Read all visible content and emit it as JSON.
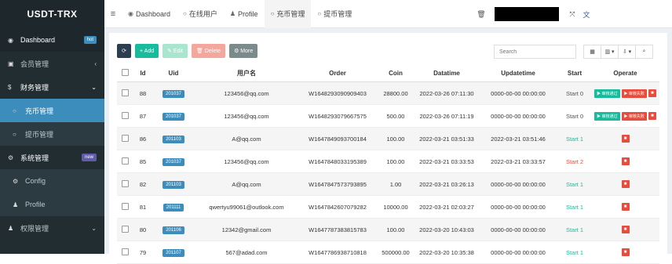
{
  "sidebar": {
    "logo": "USDT-TRX",
    "items": [
      {
        "label": "Dashboard",
        "icon": "dashboard-icon",
        "glyph": "◉",
        "badge": "hot"
      },
      {
        "label": "会员管理",
        "icon": "member-icon",
        "glyph": "▣",
        "chev": "‹"
      },
      {
        "label": "财务管理",
        "icon": "finance-icon",
        "glyph": "$",
        "chev": "⌄"
      },
      {
        "label": "充币管理",
        "icon": "circle-icon",
        "glyph": "○"
      },
      {
        "label": "提币管理",
        "icon": "circle-icon",
        "glyph": "○"
      },
      {
        "label": "系统管理",
        "icon": "gears-icon",
        "glyph": "⚙",
        "badge": "new"
      },
      {
        "label": "Config",
        "icon": "gear-icon",
        "glyph": "⚙"
      },
      {
        "label": "Profile",
        "icon": "user-icon",
        "glyph": "♟"
      },
      {
        "label": "权限管理",
        "icon": "group-icon",
        "glyph": "♟",
        "chev": "⌄"
      }
    ]
  },
  "topbar": {
    "menu_glyph": "≡",
    "tabs": [
      {
        "label": "Dashboard",
        "glyph": "◉"
      },
      {
        "label": "在线用户",
        "glyph": "○"
      },
      {
        "label": "Profile",
        "glyph": "♟"
      },
      {
        "label": "充币管理",
        "glyph": "○"
      },
      {
        "label": "提币管理",
        "glyph": "○"
      }
    ],
    "right_icons": {
      "trash": "🗑",
      "expand": "⤧",
      "lang": "文"
    }
  },
  "toolbar": {
    "refresh": "⟳",
    "add": "+ Add",
    "edit": "✎ Edit",
    "delete": "🗑 Delete",
    "more": "⚙ More",
    "search_placeholder": "Search",
    "r1": "▦",
    "r2": "▥ ▾",
    "r3": "⇩ ▾",
    "r4": "⌕"
  },
  "table": {
    "headers": {
      "id": "Id",
      "uid": "Uid",
      "name": "用户名",
      "order": "Order",
      "coin": "Coin",
      "datatime": "Datatime",
      "updatetime": "Updatetime",
      "start": "Start",
      "operate": "Operate"
    },
    "op_labels": {
      "approve": "▶ 审核通过",
      "reject": "▶ 审核失败",
      "del": "■"
    },
    "rows": [
      {
        "id": "88",
        "uid": "201037",
        "name": "123456@qq.com",
        "order": "W1648293090909403",
        "coin": "28800.00",
        "datatime": "2022-03-26 07:11:30",
        "updatetime": "0000-00-00 00:00:00",
        "start": "Start 0",
        "status": "pending"
      },
      {
        "id": "87",
        "uid": "201037",
        "name": "123456@qq.com",
        "order": "W1648293079667575",
        "coin": "500.00",
        "datatime": "2022-03-26 07:11:19",
        "updatetime": "0000-00-00 00:00:00",
        "start": "Start 0",
        "status": "pending"
      },
      {
        "id": "86",
        "uid": "201103",
        "name": "A@qq.com",
        "order": "W1647849093700184",
        "coin": "100.00",
        "datatime": "2022-03-21 03:51:33",
        "updatetime": "2022-03-21 03:51:46",
        "start": "Start 1",
        "status": "ok"
      },
      {
        "id": "85",
        "uid": "201037",
        "name": "123456@qq.com",
        "order": "W1647848033195389",
        "coin": "100.00",
        "datatime": "2022-03-21 03:33:53",
        "updatetime": "2022-03-21 03:33:57",
        "start": "Start 2",
        "status": "fail"
      },
      {
        "id": "82",
        "uid": "201103",
        "name": "A@qq.com",
        "order": "W1647847573793895",
        "coin": "1.00",
        "datatime": "2022-03-21 03:26:13",
        "updatetime": "0000-00-00 00:00:00",
        "start": "Start 1",
        "status": "ok"
      },
      {
        "id": "81",
        "uid": "201111",
        "name": "qwertyu99061@outlook.com",
        "order": "W1647842607079282",
        "coin": "10000.00",
        "datatime": "2022-03-21 02:03:27",
        "updatetime": "0000-00-00 00:00:00",
        "start": "Start 1",
        "status": "ok"
      },
      {
        "id": "80",
        "uid": "201106",
        "name": "12342@gmail.com",
        "order": "W1647787383815783",
        "coin": "100.00",
        "datatime": "2022-03-20 10:43:03",
        "updatetime": "0000-00-00 00:00:00",
        "start": "Start 1",
        "status": "ok"
      },
      {
        "id": "79",
        "uid": "201107",
        "name": "567@adad.com",
        "order": "W1647786938710818",
        "coin": "500000.00",
        "datatime": "2022-03-20 10:35:38",
        "updatetime": "0000-00-00 00:00:00",
        "start": "Start 1",
        "status": "ok"
      }
    ]
  },
  "colors": {
    "sidebar_bg": "#222d32",
    "active": "#3c8dbc",
    "green": "#18bc9c",
    "red": "#e74c3c"
  }
}
